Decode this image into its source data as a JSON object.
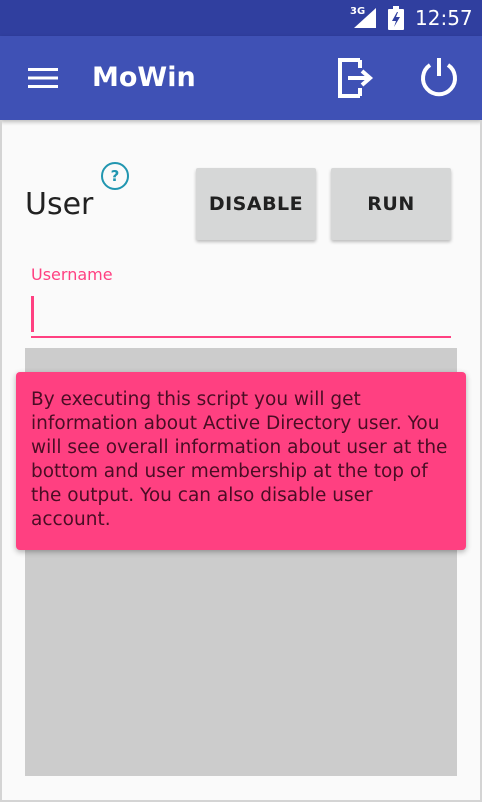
{
  "status_bar": {
    "network": "3G",
    "time": "12:57",
    "colors": {
      "background": "#303f9f"
    }
  },
  "app_bar": {
    "title": "MoWin",
    "icons": {
      "menu": "hamburger-menu-icon",
      "logout": "logout-icon",
      "power": "power-icon"
    },
    "colors": {
      "background": "#3f51b5"
    }
  },
  "main": {
    "heading": "User",
    "help_icon": "?",
    "buttons": {
      "disable_label": "DISABLE",
      "run_label": "RUN"
    },
    "username": {
      "label": "Username",
      "value": ""
    },
    "tooltip": {
      "text": "By executing this script you will get information about Active Directory user. You will see overall information about user at the bottom and user membership at the top of the output. You can also disable user account."
    },
    "colors": {
      "accent": "#ff4081",
      "help": "#2196b0",
      "output_background": "#cccccc"
    }
  }
}
